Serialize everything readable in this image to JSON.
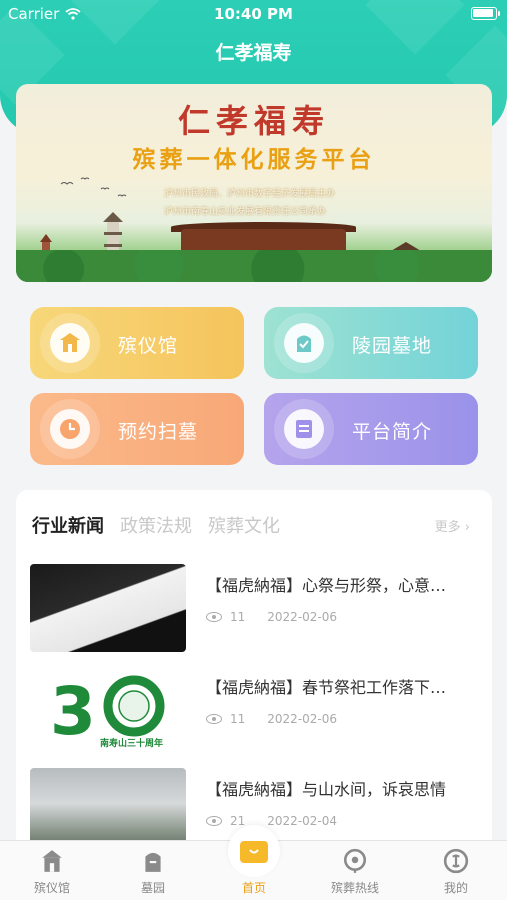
{
  "status_bar": {
    "carrier": "Carrier",
    "time": "10:40 PM"
  },
  "nav": {
    "title": "仁孝福寿"
  },
  "banner": {
    "title_line1": "仁孝福寿",
    "title_line2": "殡葬一体化服务平台",
    "organizer": "泸州市民政局、泸州市数字经济发展局主办",
    "undertaker": "泸州市南寿山实业发展有限责任公司承办"
  },
  "menu": [
    {
      "label": "殡仪馆",
      "icon": "funeral-hall-icon"
    },
    {
      "label": "陵园墓地",
      "icon": "cemetery-icon"
    },
    {
      "label": "预约扫墓",
      "icon": "clock-icon"
    },
    {
      "label": "平台简介",
      "icon": "document-icon"
    }
  ],
  "news": {
    "tabs": [
      "行业新闻",
      "政策法规",
      "殡葬文化"
    ],
    "active_tab": "行业新闻",
    "more_label": "更多",
    "items": [
      {
        "title": "【福虎納福】心祭与形祭，心意…",
        "views": "11",
        "date": "2022-02-06"
      },
      {
        "title": "【福虎納福】春节祭祀工作落下…",
        "views": "11",
        "date": "2022-02-06",
        "thumb_text": "南寿山三十周年"
      },
      {
        "title": "【福虎納福】与山水间，诉哀思情",
        "views": "21",
        "date": "2022-02-04"
      }
    ]
  },
  "tabbar": [
    {
      "label": "殡仪馆",
      "icon": "funeral-hall-icon"
    },
    {
      "label": "墓园",
      "icon": "cemetery-icon"
    },
    {
      "label": "首页",
      "icon": "home-icon",
      "active": true
    },
    {
      "label": "殡葬热线",
      "icon": "hotline-icon"
    },
    {
      "label": "我的",
      "icon": "profile-icon"
    }
  ],
  "colors": {
    "header": "#2ccfb6",
    "accent": "#e9a013"
  }
}
